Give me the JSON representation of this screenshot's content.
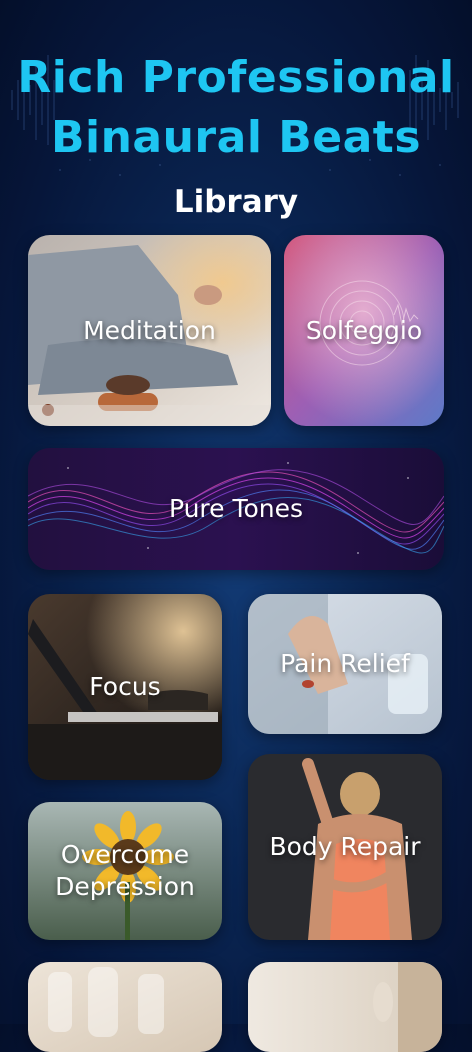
{
  "hero": {
    "headline_line1": "Rich Professional",
    "headline_line2": "Binaural Beats",
    "section_title": "Library"
  },
  "colors": {
    "accent": "#1ec6f2",
    "background": "#0a2552",
    "text": "#ffffff"
  },
  "library": {
    "meditation": "Meditation",
    "solfeggio": "Solfeggio",
    "pure_tones": "Pure Tones",
    "focus": "Focus",
    "pain_relief": "Pain Relief",
    "overcome_depression": "Overcome\nDepression",
    "body_repair": "Body Repair"
  }
}
